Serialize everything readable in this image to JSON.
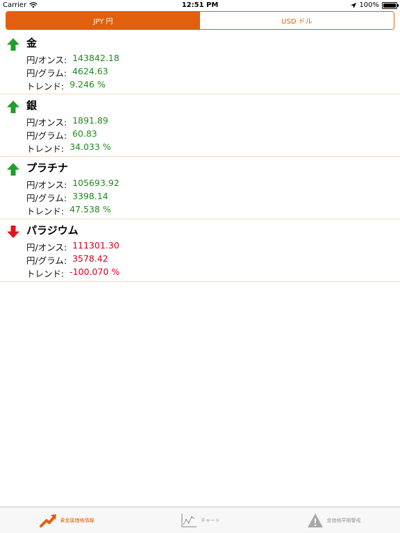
{
  "status_bar": {
    "carrier": "Carrier",
    "time": "12:51 PM",
    "battery": "100%"
  },
  "currency_switch": {
    "jpy_label": "JPY 円",
    "usd_label": "USD ドル",
    "selected": "JPY"
  },
  "metals": [
    {
      "name": "金",
      "trend_direction": "up",
      "per_ounce_label": "円/オンス:",
      "per_ounce_value": "143842.18",
      "per_gram_label": "円/グラム:",
      "per_gram_value": "4624.63",
      "trend_label": "トレンド:",
      "trend_value": "9.246 %"
    },
    {
      "name": "銀",
      "trend_direction": "up",
      "per_ounce_label": "円/オンス:",
      "per_ounce_value": "1891.89",
      "per_gram_label": "円/グラム:",
      "per_gram_value": "60.83",
      "trend_label": "トレンド:",
      "trend_value": "34.033 %"
    },
    {
      "name": "プラチナ",
      "trend_direction": "up",
      "per_ounce_label": "円/オンス:",
      "per_ounce_value": "105693.92",
      "per_gram_label": "円/グラム:",
      "per_gram_value": "3398.14",
      "trend_label": "トレンド:",
      "trend_value": "47.538 %"
    },
    {
      "name": "パラジウム",
      "trend_direction": "down",
      "per_ounce_label": "円/オンス:",
      "per_ounce_value": "111301.30",
      "per_gram_label": "円/グラム:",
      "per_gram_value": "3578.42",
      "trend_label": "トレンド:",
      "trend_value": "-100.070 %"
    }
  ],
  "colors": {
    "accent": "#e2600d",
    "up": "#1f8a1f",
    "down": "#d0021b",
    "separator": "#f6d9c4"
  },
  "tab_bar": {
    "tabs": [
      {
        "label": "貴金属価格情報",
        "icon": "trend-up-icon",
        "active": true
      },
      {
        "label": "チャート",
        "icon": "line-chart-icon",
        "active": false
      },
      {
        "label": "金価格早期警戒",
        "icon": "warning-icon",
        "active": false
      }
    ]
  }
}
